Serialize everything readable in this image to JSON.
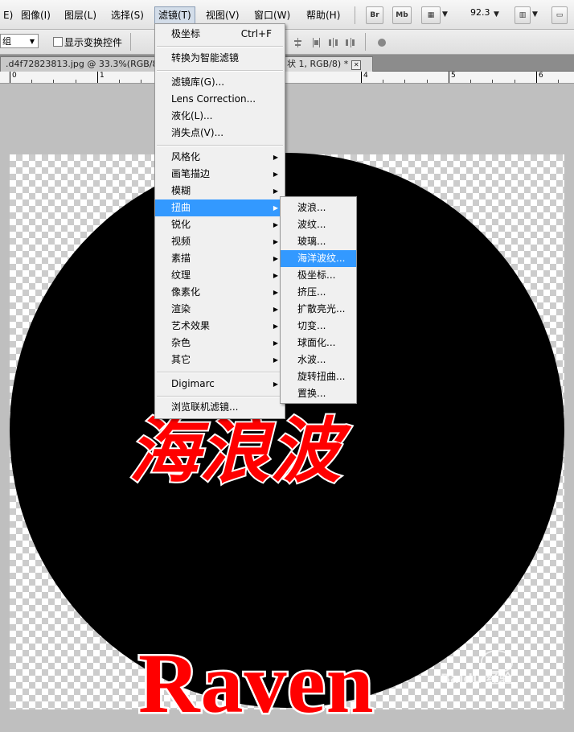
{
  "menubar": {
    "items": [
      "E)",
      "图像(I)",
      "图层(L)",
      "选择(S)",
      "滤镜(T)",
      "视图(V)",
      "窗口(W)",
      "帮助(H)"
    ],
    "br_label": "Br",
    "mb_label": "Mb",
    "zoom": "92.3"
  },
  "options": {
    "group_value": "组",
    "transform_label": "显示变换控件"
  },
  "tabs": {
    "doc1": ".d4f72823813.jpg @ 33.3%(RGB/8)",
    "doc2": "状 1, RGB/8) *",
    "close": "✕"
  },
  "ruler": {
    "labels": [
      "0",
      "1",
      "4",
      "5",
      "6"
    ]
  },
  "canvas": {
    "title_cn": "海浪波",
    "title_en": "Raven",
    "circle_color": "#000000",
    "text_color": "#ff0000"
  },
  "filter_menu": {
    "items": [
      {
        "label": "极坐标",
        "shortcut": "Ctrl+F"
      },
      {
        "label": "转换为智能滤镜"
      },
      {
        "label": "滤镜库(G)..."
      },
      {
        "label": "Lens Correction..."
      },
      {
        "label": "液化(L)..."
      },
      {
        "label": "消失点(V)..."
      },
      {
        "label": "风格化",
        "submenu": true
      },
      {
        "label": "画笔描边",
        "submenu": true
      },
      {
        "label": "模糊",
        "submenu": true
      },
      {
        "label": "扭曲",
        "submenu": true,
        "highlighted": true
      },
      {
        "label": "锐化",
        "submenu": true
      },
      {
        "label": "视频",
        "submenu": true
      },
      {
        "label": "素描",
        "submenu": true
      },
      {
        "label": "纹理",
        "submenu": true
      },
      {
        "label": "像素化",
        "submenu": true
      },
      {
        "label": "渲染",
        "submenu": true
      },
      {
        "label": "艺术效果",
        "submenu": true
      },
      {
        "label": "杂色",
        "submenu": true
      },
      {
        "label": "其它",
        "submenu": true
      },
      {
        "label": "Digimarc",
        "submenu": true
      },
      {
        "label": "浏览联机滤镜..."
      }
    ]
  },
  "distort_submenu": {
    "items": [
      {
        "label": "波浪..."
      },
      {
        "label": "波纹..."
      },
      {
        "label": "玻璃..."
      },
      {
        "label": "海洋波纹...",
        "highlighted": true
      },
      {
        "label": "极坐标..."
      },
      {
        "label": "挤压..."
      },
      {
        "label": "扩散亮光..."
      },
      {
        "label": "切变..."
      },
      {
        "label": "球面化..."
      },
      {
        "label": "水波..."
      },
      {
        "label": "旋转扭曲..."
      },
      {
        "label": "置换..."
      }
    ]
  },
  "watermark": {
    "text": "Baidu 经验"
  }
}
